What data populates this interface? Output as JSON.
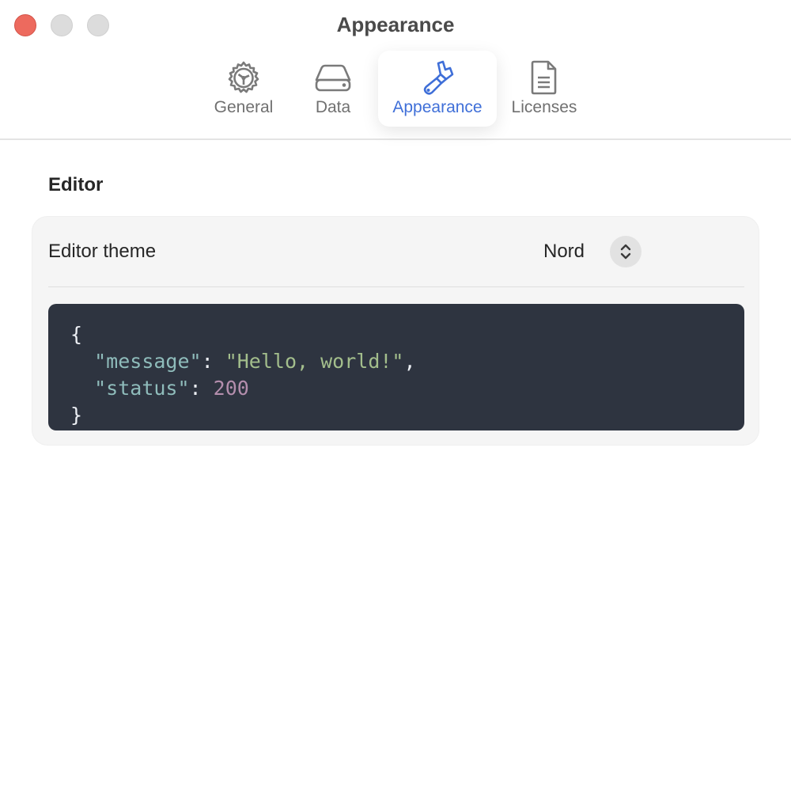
{
  "window": {
    "title": "Appearance"
  },
  "toolbar": {
    "tabs": [
      {
        "label": "General",
        "icon": "gear-icon",
        "active": false
      },
      {
        "label": "Data",
        "icon": "drive-icon",
        "active": false
      },
      {
        "label": "Appearance",
        "icon": "paintbrush-icon",
        "active": true
      },
      {
        "label": "Licenses",
        "icon": "document-icon",
        "active": false
      }
    ]
  },
  "editor_section": {
    "title": "Editor",
    "theme_label": "Editor theme",
    "theme_value": "Nord",
    "preview": {
      "open_brace": "{",
      "key1": "\"message\"",
      "colon": ":",
      "value1": "\"Hello, world!\"",
      "comma": ",",
      "key2": "\"status\"",
      "value2": "200",
      "close_brace": "}"
    }
  },
  "colors": {
    "accent": "#3f6fd8",
    "close_button": "#ed6a5e",
    "code_background": "#2e3440",
    "code_key": "#8fbcbb",
    "code_string": "#a3be8c",
    "code_number": "#b48ead"
  }
}
